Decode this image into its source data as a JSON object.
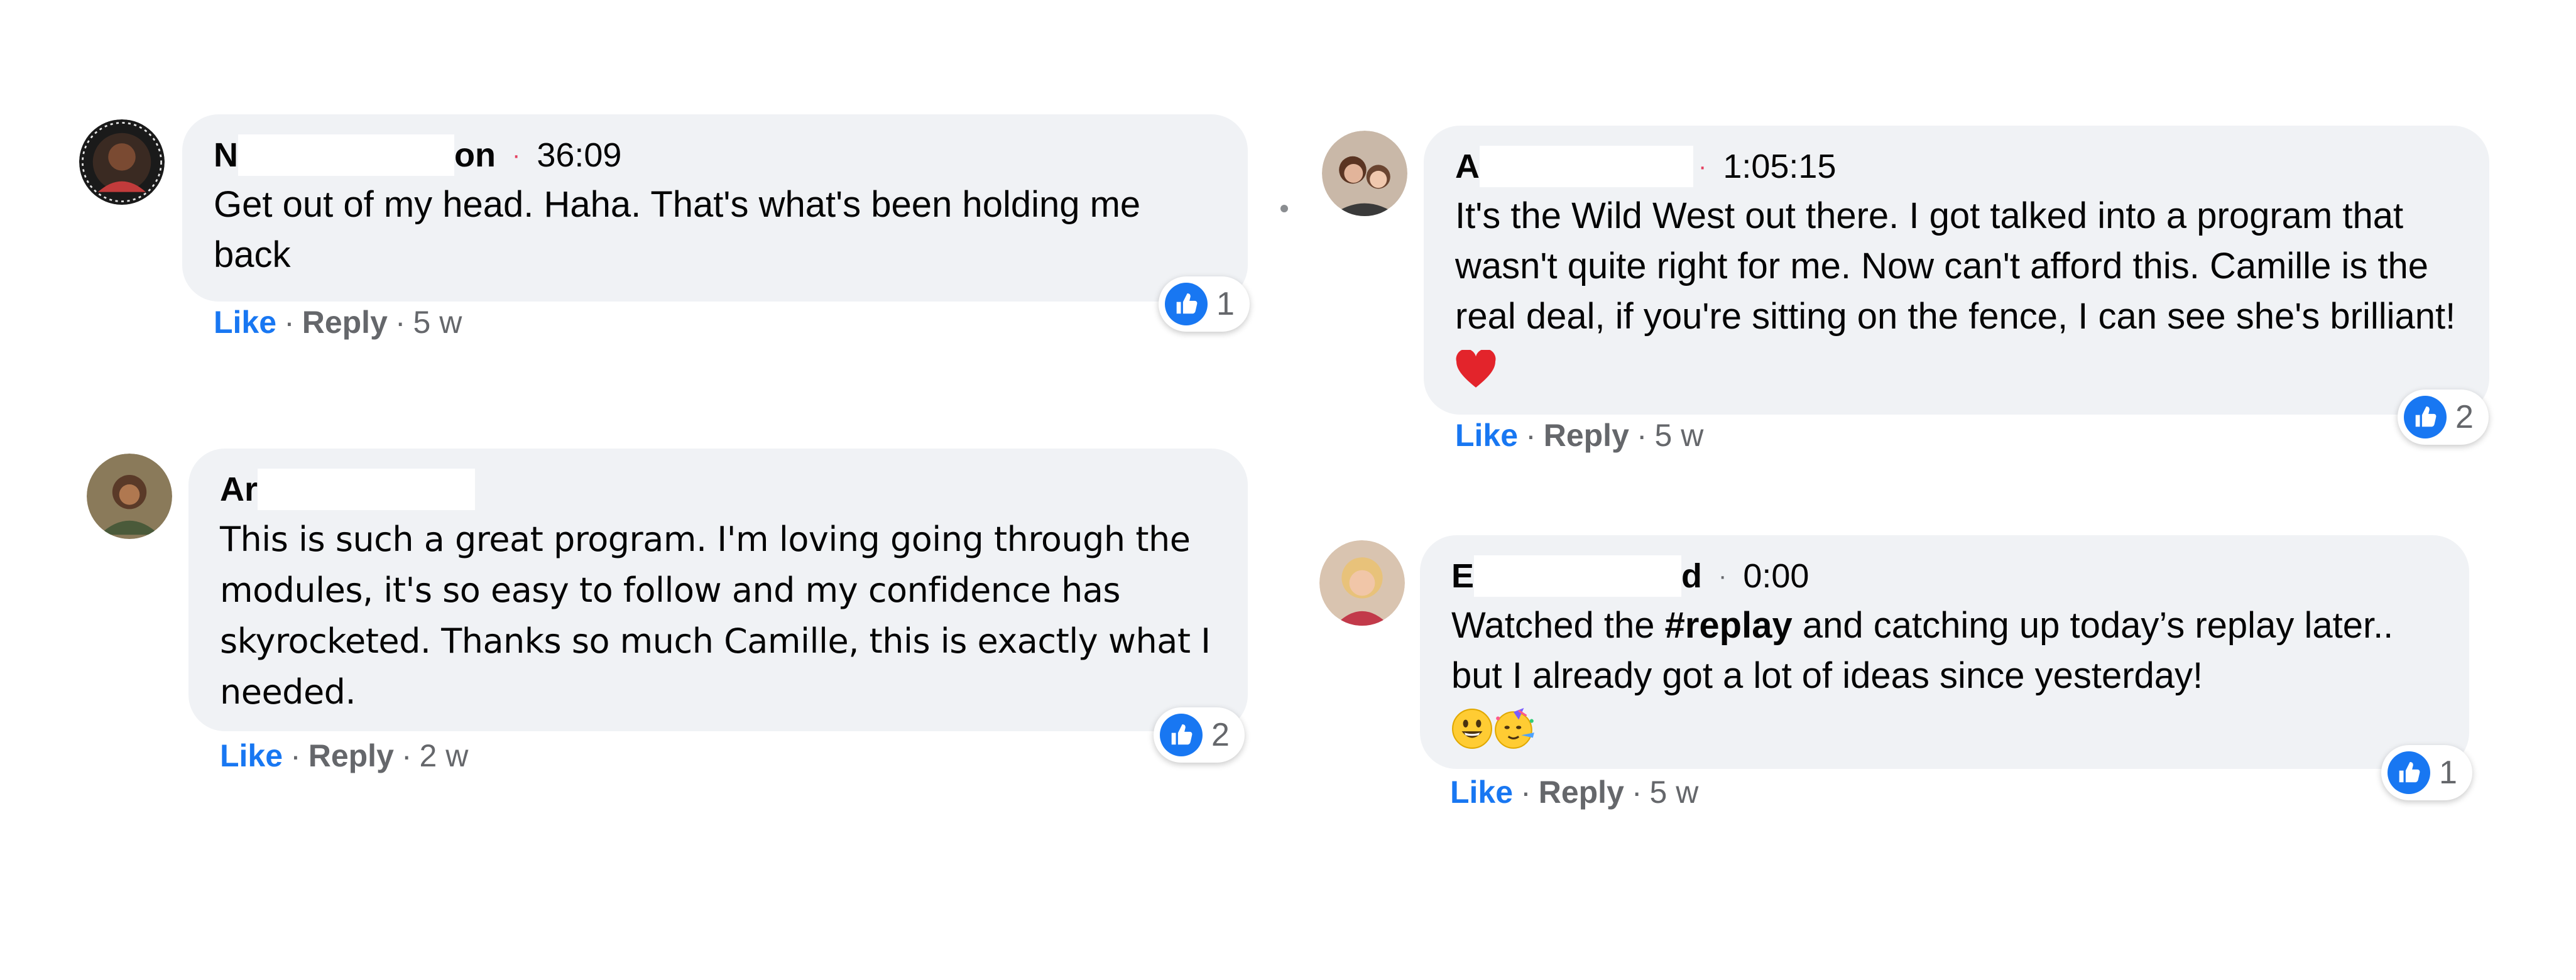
{
  "comments": [
    {
      "author_start": "N",
      "author_end": "on",
      "timestamp": "36:09",
      "text": "Get out of my head. Haha. That's what's been holding me back",
      "like_label": "Like",
      "reply_label": "Reply",
      "age": "5 w",
      "reaction_count": "1"
    },
    {
      "author_start": "Ar",
      "author_end": "",
      "timestamp": "",
      "text": "This is such a great program. I'm loving going through the modules, it's so easy to follow and my confidence has skyrocketed. Thanks so much Camille, this is exactly what I needed.",
      "like_label": "Like",
      "reply_label": "Reply",
      "age": "2 w",
      "reaction_count": "2"
    },
    {
      "author_start": "A",
      "author_end": "",
      "timestamp": "1:05:15",
      "text": "It's the Wild West out there. I got talked into a program that wasn't quite right for me. Now can't afford this. Camille is the real deal, if you're sitting on the fence, I can see she's brilliant!",
      "like_label": "Like",
      "reply_label": "Reply",
      "age": "5 w",
      "reaction_count": "2"
    },
    {
      "author_start": "E",
      "author_end": "d",
      "timestamp": "0:00",
      "text_before": "Watched the ",
      "hashtag": "#replay",
      "text_after": " and catching up today’s replay later.. but I already got a lot of ideas since yesterday!",
      "like_label": "Like",
      "reply_label": "Reply",
      "age": "5 w",
      "reaction_count": "1"
    }
  ],
  "separator": "·",
  "colors": {
    "bubble": "#f0f2f5",
    "like_blue": "#1877f2",
    "meta_grey": "#65676b",
    "timestamp_dot": "#e4405f"
  },
  "icons": [
    "thumbs-up-reaction-icon",
    "red-heart-emoji",
    "grinning-face-emoji",
    "partying-face-emoji"
  ]
}
